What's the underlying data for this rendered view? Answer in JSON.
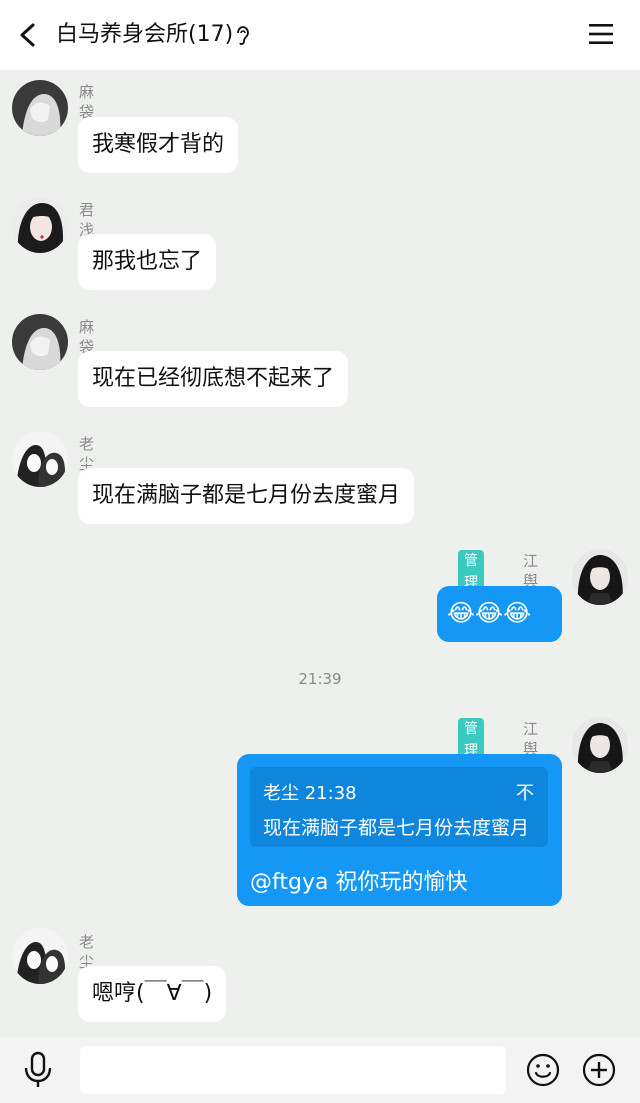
{
  "header": {
    "title": "白马养身会所(17)",
    "icons": [
      "back-icon",
      "ear-icon",
      "menu-icon"
    ]
  },
  "messages": [
    {
      "sender": "麻袋",
      "text": "我寒假才背的"
    },
    {
      "sender": "君浅",
      "text": "那我也忘了"
    },
    {
      "sender": "麻袋",
      "text": "现在已经彻底想不起来了"
    },
    {
      "sender": "老尘",
      "text": "现在满脑子都是七月份去度蜜月"
    },
    {
      "sender": "江舆",
      "badge": "管理员",
      "text": "😂😂😂"
    },
    {
      "sender": "江舆",
      "badge": "管理员",
      "quote": {
        "author_time": "老尘 21:38",
        "arrow": "不",
        "text": "现在满脑子都是七月份去度蜜月"
      },
      "text": "@ftgya 祝你玩的愉快"
    },
    {
      "sender": "老尘",
      "text": "嗯哼(￣∀￣)"
    }
  ],
  "time_separator": "21:39",
  "input": {
    "value": "",
    "placeholder": ""
  },
  "colors": {
    "background": "#eef0ee",
    "my_bubble": "#1597f5",
    "badge": "#3cc9c0",
    "sender_name": "#8a8a8a"
  }
}
